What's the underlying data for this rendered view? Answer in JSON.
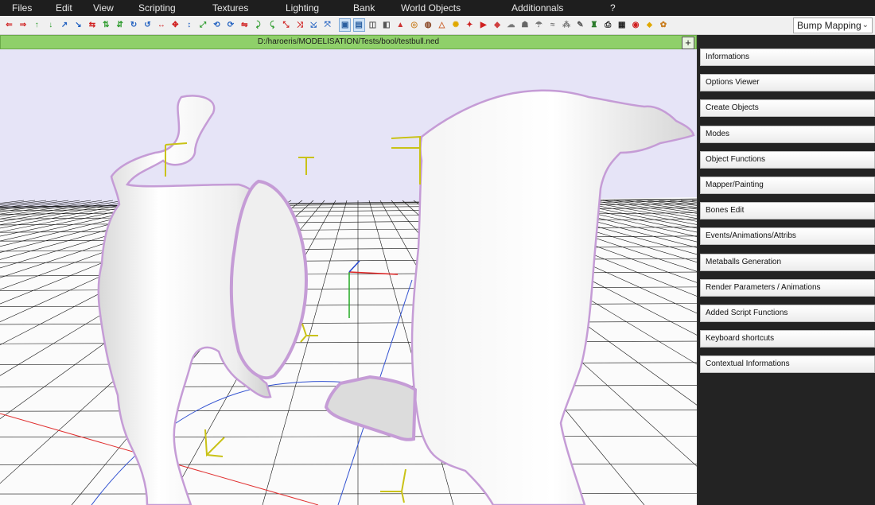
{
  "menu": [
    "Files",
    "Edit",
    "View",
    "Scripting",
    "Textures",
    "Lighting",
    "Bank",
    "World Objects",
    "Additionnals",
    "?"
  ],
  "toolbar": {
    "icons": [
      {
        "name": "arrow-left-icon",
        "glyph": "⇐",
        "color": "#d02020"
      },
      {
        "name": "arrow-right-icon",
        "glyph": "⇒",
        "color": "#d02020"
      },
      {
        "name": "move-up-icon",
        "glyph": "↑",
        "color": "#2a9a2a"
      },
      {
        "name": "move-down-icon",
        "glyph": "↓",
        "color": "#2a9a2a"
      },
      {
        "name": "axis-z-icon",
        "glyph": "↗",
        "color": "#2060c0"
      },
      {
        "name": "axis-y-icon",
        "glyph": "↘",
        "color": "#2060c0"
      },
      {
        "name": "shift-x-icon",
        "glyph": "⇆",
        "color": "#d02020"
      },
      {
        "name": "shift-y-icon",
        "glyph": "⇅",
        "color": "#2a9a2a"
      },
      {
        "name": "shift-z-icon",
        "glyph": "⇵",
        "color": "#2a9a2a"
      },
      {
        "name": "rotate-y-icon",
        "glyph": "↻",
        "color": "#2060c0"
      },
      {
        "name": "rotate-z-icon",
        "glyph": "↺",
        "color": "#2060c0"
      },
      {
        "name": "scale-x-icon",
        "glyph": "↔",
        "color": "#d02020"
      },
      {
        "name": "scale-xy-icon",
        "glyph": "✥",
        "color": "#d02020"
      },
      {
        "name": "scale-z-icon",
        "glyph": "↕",
        "color": "#2060c0"
      },
      {
        "name": "uniform-scale-icon",
        "glyph": "⤢",
        "color": "#2a9a2a"
      },
      {
        "name": "rotate-x-icon",
        "glyph": "⟲",
        "color": "#2060c0"
      },
      {
        "name": "rotate-y2-icon",
        "glyph": "⟳",
        "color": "#2060c0"
      },
      {
        "name": "mirror-x-icon",
        "glyph": "⇋",
        "color": "#d02020"
      },
      {
        "name": "twist-icon",
        "glyph": "⤸",
        "color": "#2a9a2a"
      },
      {
        "name": "bend-icon",
        "glyph": "⤹",
        "color": "#2a9a2a"
      },
      {
        "name": "taper-icon",
        "glyph": "⤡",
        "color": "#d02020"
      },
      {
        "name": "skew-icon",
        "glyph": "⤨",
        "color": "#d02020"
      },
      {
        "name": "stretch-icon",
        "glyph": "⤩",
        "color": "#2060c0"
      },
      {
        "name": "noise-icon",
        "glyph": "⤧",
        "color": "#2060c0"
      },
      {
        "name": "select-faces-icon",
        "glyph": "▣",
        "color": "#2a5fa0"
      },
      {
        "name": "select-object-icon",
        "glyph": "▤",
        "color": "#2a5fa0"
      },
      {
        "name": "box-icon",
        "glyph": "◫",
        "color": "#555555"
      },
      {
        "name": "cube-icon",
        "glyph": "◧",
        "color": "#555555"
      },
      {
        "name": "cone-icon",
        "glyph": "▲",
        "color": "#cc3333"
      },
      {
        "name": "torus-icon",
        "glyph": "◎",
        "color": "#cc8833"
      },
      {
        "name": "cylinder-icon",
        "glyph": "◍",
        "color": "#884422"
      },
      {
        "name": "pyramid-icon",
        "glyph": "△",
        "color": "#cc6633"
      },
      {
        "name": "light-bulb-icon",
        "glyph": "✺",
        "color": "#e0a800"
      },
      {
        "name": "spot-light-icon",
        "glyph": "✦",
        "color": "#cc2222"
      },
      {
        "name": "play-icon",
        "glyph": "▶",
        "color": "#d02020"
      },
      {
        "name": "render-icon",
        "glyph": "◆",
        "color": "#d04040"
      },
      {
        "name": "landscape-icon",
        "glyph": "☁",
        "color": "#777777"
      },
      {
        "name": "terrain-icon",
        "glyph": "☗",
        "color": "#666666"
      },
      {
        "name": "sky-icon",
        "glyph": "☂",
        "color": "#777777"
      },
      {
        "name": "water-icon",
        "glyph": "≈",
        "color": "#777777"
      },
      {
        "name": "particles-icon",
        "glyph": "⁂",
        "color": "#777777"
      },
      {
        "name": "script-icon",
        "glyph": "✎",
        "color": "#555555"
      },
      {
        "name": "bottle-icon",
        "glyph": "♜",
        "color": "#2a7a2a"
      },
      {
        "name": "printer-icon",
        "glyph": "⎙",
        "color": "#222222"
      },
      {
        "name": "monitor-icon",
        "glyph": "▦",
        "color": "#222222"
      },
      {
        "name": "stop-icon",
        "glyph": "◉",
        "color": "#d02020"
      },
      {
        "name": "hint-icon",
        "glyph": "⬥",
        "color": "#e0a800"
      },
      {
        "name": "palette-icon",
        "glyph": "✿",
        "color": "#c87a1a"
      }
    ],
    "mode_select": "Bump Mapping"
  },
  "viewport": {
    "path": "D:/haroeris/MODELISATION/Tests/bool/testbull.ned",
    "plus": "+"
  },
  "panel": {
    "items": [
      "Informations",
      "Options Viewer",
      "Create Objects",
      "Modes",
      "Object Functions",
      "Mapper/Painting",
      "Bones Edit",
      "Events/Animations/Attribs",
      "Metaballs Generation",
      "Render Parameters / Animations",
      "Added Script Functions",
      "Keyboard shortcuts",
      "Contextual Informations"
    ]
  },
  "colors": {
    "menubar": "#1e1e1e",
    "pathbar": "#8fd06a",
    "sky": "#e6e4f7",
    "panel": "#232323",
    "mesh_outline": "#c59cd6",
    "gizmo": "#c9c217"
  }
}
